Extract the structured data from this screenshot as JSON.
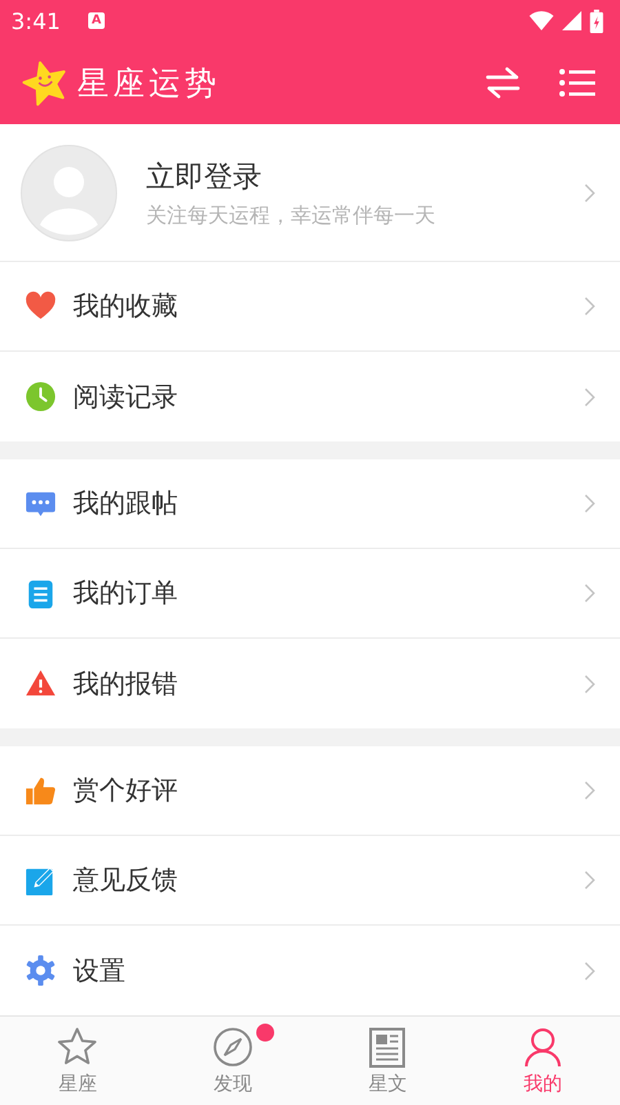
{
  "status_bar": {
    "time": "3:41",
    "notification": "A"
  },
  "app_bar": {
    "title": "星座运势"
  },
  "profile": {
    "title": "立即登录",
    "subtitle": "关注每天运程，幸运常伴每一天"
  },
  "menu_groups": [
    [
      {
        "label": "我的收藏",
        "kind": "heart"
      },
      {
        "label": "阅读记录",
        "kind": "clock"
      }
    ],
    [
      {
        "label": "我的跟帖",
        "kind": "chat"
      },
      {
        "label": "我的订单",
        "kind": "clipboard"
      },
      {
        "label": "我的报错",
        "kind": "warning"
      }
    ],
    [
      {
        "label": "赏个好评",
        "kind": "thumb"
      },
      {
        "label": "意见反馈",
        "kind": "edit"
      },
      {
        "label": "设置",
        "kind": "gear"
      }
    ]
  ],
  "tabs": [
    {
      "label": "星座",
      "kind": "star",
      "selected": false,
      "badge": false
    },
    {
      "label": "发现",
      "kind": "compass",
      "selected": false,
      "badge": true
    },
    {
      "label": "星文",
      "kind": "news",
      "selected": false,
      "badge": false
    },
    {
      "label": "我的",
      "kind": "person",
      "selected": true,
      "badge": false
    }
  ]
}
